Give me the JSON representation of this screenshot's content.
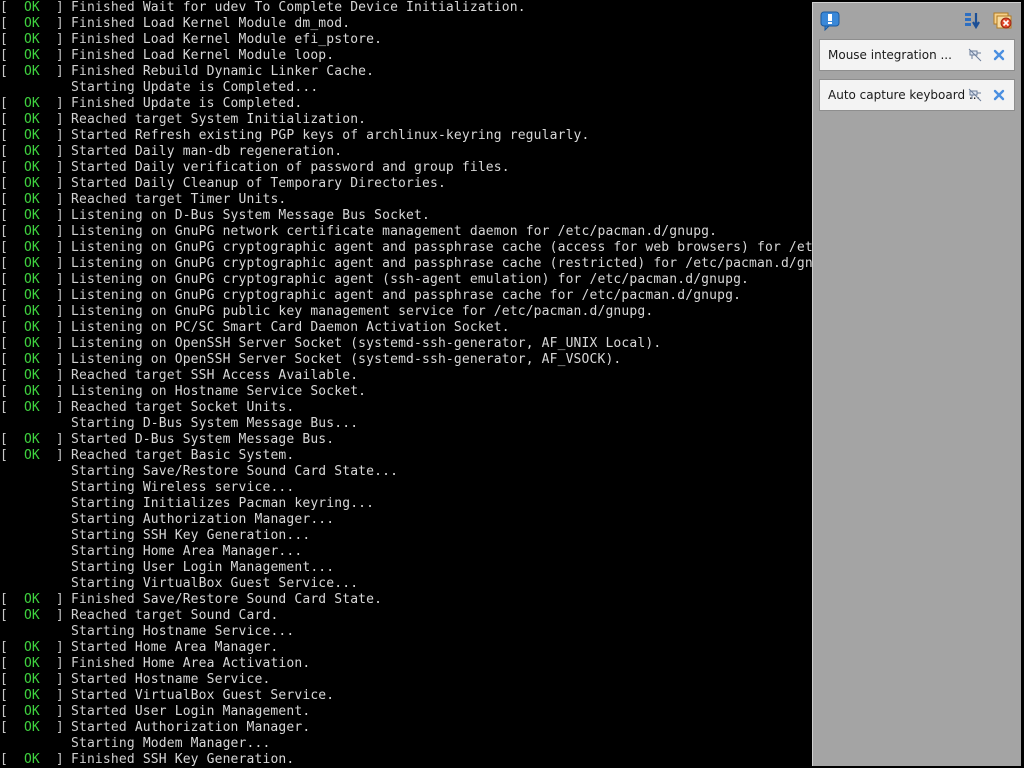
{
  "console": {
    "status_ok": "OK",
    "lines": [
      {
        "ok": true,
        "verb": "Finished",
        "text": "Wait for udev To Complete Device Initialization."
      },
      {
        "ok": true,
        "verb": "Finished",
        "text": "Load Kernel Module dm_mod."
      },
      {
        "ok": true,
        "verb": "Finished",
        "text": "Load Kernel Module efi_pstore."
      },
      {
        "ok": true,
        "verb": "Finished",
        "text": "Load Kernel Module loop."
      },
      {
        "ok": true,
        "verb": "Finished",
        "text": "Rebuild Dynamic Linker Cache."
      },
      {
        "ok": false,
        "verb": "Starting",
        "text": "Update is Completed..."
      },
      {
        "ok": true,
        "verb": "Finished",
        "text": "Update is Completed."
      },
      {
        "ok": true,
        "verb": "Reached target",
        "text": "System Initialization."
      },
      {
        "ok": true,
        "verb": "Started",
        "text": "Refresh existing PGP keys of archlinux-keyring regularly."
      },
      {
        "ok": true,
        "verb": "Started",
        "text": "Daily man-db regeneration."
      },
      {
        "ok": true,
        "verb": "Started",
        "text": "Daily verification of password and group files."
      },
      {
        "ok": true,
        "verb": "Started",
        "text": "Daily Cleanup of Temporary Directories."
      },
      {
        "ok": true,
        "verb": "Reached target",
        "text": "Timer Units."
      },
      {
        "ok": true,
        "verb": "Listening on",
        "text": "D-Bus System Message Bus Socket."
      },
      {
        "ok": true,
        "verb": "Listening on",
        "text": "GnuPG network certificate management daemon for /etc/pacman.d/gnupg."
      },
      {
        "ok": true,
        "verb": "Listening on",
        "text": "GnuPG cryptographic agent and passphrase cache (access for web browsers) for /etc/pacman.d/gnupg."
      },
      {
        "ok": true,
        "verb": "Listening on",
        "text": "GnuPG cryptographic agent and passphrase cache (restricted) for /etc/pacman.d/gnupg."
      },
      {
        "ok": true,
        "verb": "Listening on",
        "text": "GnuPG cryptographic agent (ssh-agent emulation) for /etc/pacman.d/gnupg."
      },
      {
        "ok": true,
        "verb": "Listening on",
        "text": "GnuPG cryptographic agent and passphrase cache for /etc/pacman.d/gnupg."
      },
      {
        "ok": true,
        "verb": "Listening on",
        "text": "GnuPG public key management service for /etc/pacman.d/gnupg."
      },
      {
        "ok": true,
        "verb": "Listening on",
        "text": "PC/SC Smart Card Daemon Activation Socket."
      },
      {
        "ok": true,
        "verb": "Listening on",
        "text": "OpenSSH Server Socket (systemd-ssh-generator, AF_UNIX Local)."
      },
      {
        "ok": true,
        "verb": "Listening on",
        "text": "OpenSSH Server Socket (systemd-ssh-generator, AF_VSOCK)."
      },
      {
        "ok": true,
        "verb": "Reached target",
        "text": "SSH Access Available."
      },
      {
        "ok": true,
        "verb": "Listening on",
        "text": "Hostname Service Socket."
      },
      {
        "ok": true,
        "verb": "Reached target",
        "text": "Socket Units."
      },
      {
        "ok": false,
        "verb": "Starting",
        "text": "D-Bus System Message Bus..."
      },
      {
        "ok": true,
        "verb": "Started",
        "text": "D-Bus System Message Bus."
      },
      {
        "ok": true,
        "verb": "Reached target",
        "text": "Basic System."
      },
      {
        "ok": false,
        "verb": "Starting",
        "text": "Save/Restore Sound Card State..."
      },
      {
        "ok": false,
        "verb": "Starting",
        "text": "Wireless service..."
      },
      {
        "ok": false,
        "verb": "Starting",
        "text": "Initializes Pacman keyring..."
      },
      {
        "ok": false,
        "verb": "Starting",
        "text": "Authorization Manager..."
      },
      {
        "ok": false,
        "verb": "Starting",
        "text": "SSH Key Generation..."
      },
      {
        "ok": false,
        "verb": "Starting",
        "text": "Home Area Manager..."
      },
      {
        "ok": false,
        "verb": "Starting",
        "text": "User Login Management..."
      },
      {
        "ok": false,
        "verb": "Starting",
        "text": "VirtualBox Guest Service..."
      },
      {
        "ok": true,
        "verb": "Finished",
        "text": "Save/Restore Sound Card State."
      },
      {
        "ok": true,
        "verb": "Reached target",
        "text": "Sound Card."
      },
      {
        "ok": false,
        "verb": "Starting",
        "text": "Hostname Service..."
      },
      {
        "ok": true,
        "verb": "Started",
        "text": "Home Area Manager."
      },
      {
        "ok": true,
        "verb": "Finished",
        "text": "Home Area Activation."
      },
      {
        "ok": true,
        "verb": "Started",
        "text": "Hostname Service."
      },
      {
        "ok": true,
        "verb": "Started",
        "text": "VirtualBox Guest Service."
      },
      {
        "ok": true,
        "verb": "Started",
        "text": "User Login Management."
      },
      {
        "ok": true,
        "verb": "Started",
        "text": "Authorization Manager."
      },
      {
        "ok": false,
        "verb": "Starting",
        "text": "Modem Manager..."
      },
      {
        "ok": true,
        "verb": "Finished",
        "text": "SSH Key Generation."
      }
    ]
  },
  "notification_panel": {
    "icons": {
      "bubble": "notification-bubble-icon",
      "sort": "sort-order-icon",
      "close_all": "close-all-icon",
      "pin": "pin-icon",
      "close": "close-icon"
    },
    "notifications": [
      {
        "text": "Mouse integration ..."
      },
      {
        "text": "Auto capture keyboard ..."
      }
    ]
  },
  "colors": {
    "ok_green": "#3fd23f",
    "console_text": "#c8c8c8",
    "panel_bg": "#a4a4a4",
    "notification_bg": "#f3f3f3"
  }
}
